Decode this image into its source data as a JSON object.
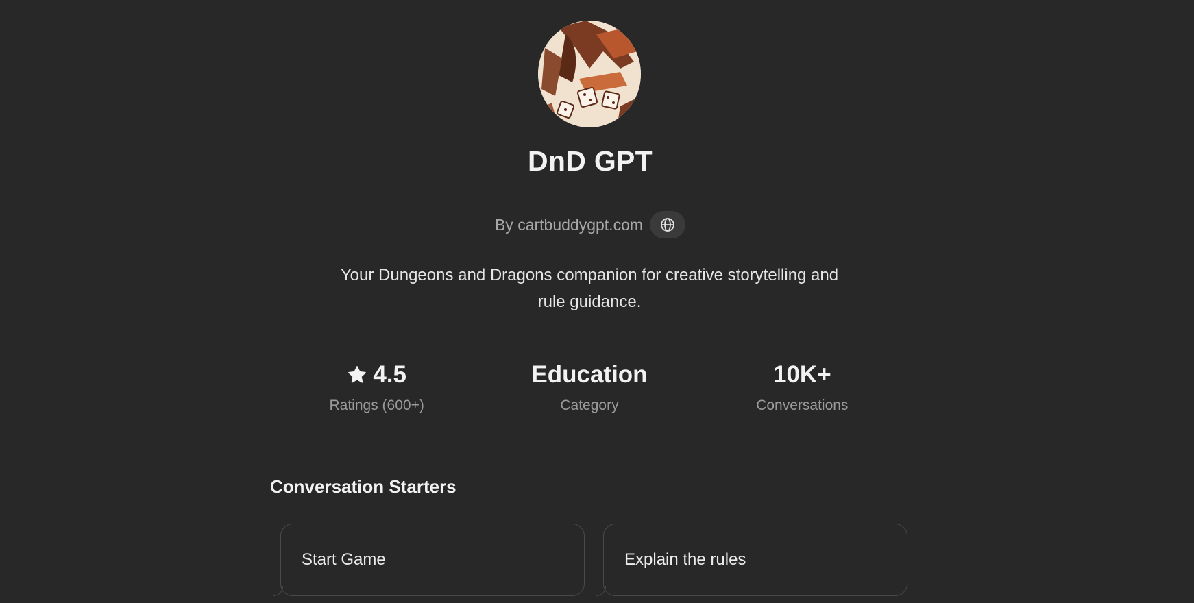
{
  "gpt": {
    "name": "DnD GPT",
    "byline": "By cartbuddygpt.com",
    "description_line1": "Your Dungeons and Dragons companion for creative storytelling and",
    "description_line2": "rule guidance.",
    "avatar_icon": "dragon-dice-avatar",
    "website_icon": "globe-icon"
  },
  "stats": {
    "rating_value": "4.5",
    "rating_label": "Ratings (600+)",
    "rating_icon": "star-icon",
    "category_value": "Education",
    "category_label": "Category",
    "conversations_value": "10K+",
    "conversations_label": "Conversations"
  },
  "starters": {
    "title": "Conversation Starters",
    "items": [
      "Start Game",
      "Explain the rules"
    ]
  },
  "colors": {
    "background": "#282828",
    "text": "#ececec",
    "muted": "#9a9a9a",
    "border": "#4a4a4a"
  }
}
